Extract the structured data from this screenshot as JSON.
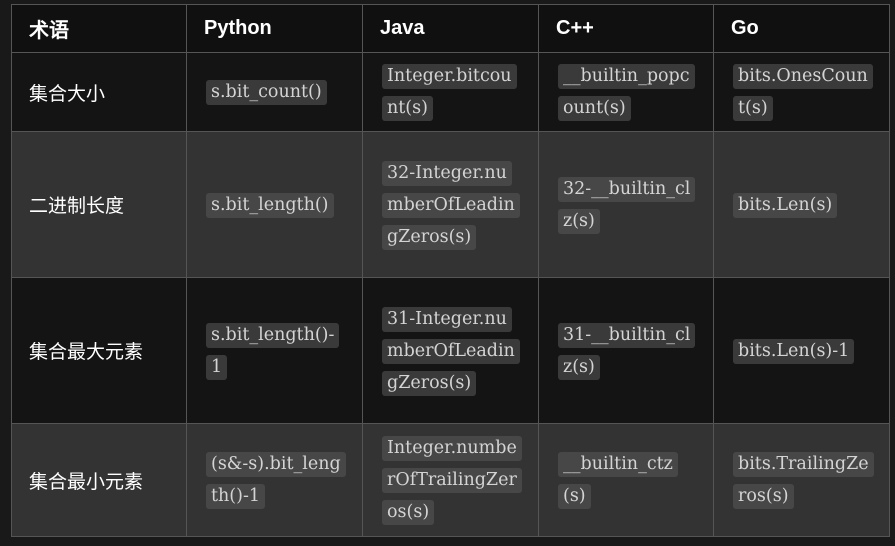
{
  "headers": [
    "术语",
    "Python",
    "Java",
    "C++",
    "Go"
  ],
  "rows": [
    {
      "term": "集合大小",
      "python": "s.bit_count()",
      "java": "Integer.bitcount(s)",
      "cpp": "__builtin_popcount(s)",
      "go": "bits.OnesCount(s)"
    },
    {
      "term": "二进制长度",
      "python": "s.bit_length()",
      "java": "32-Integer.numberOfLeadingZeros(s)",
      "cpp": "32-__builtin_clz(s)",
      "go": "bits.Len(s)"
    },
    {
      "term": "集合最大元素",
      "python": "s.bit_length()-1",
      "java": "31-Integer.numberOfLeadingZeros(s)",
      "cpp": "31-__builtin_clz(s)",
      "go": "bits.Len(s)-1"
    },
    {
      "term": "集合最小元素",
      "python": "(s&-s).bit_length()-1",
      "java": "Integer.numberOfTrailingZeros(s)",
      "cpp": "__builtin_ctz(s)",
      "go": "bits.TrailingZeros(s)"
    }
  ]
}
